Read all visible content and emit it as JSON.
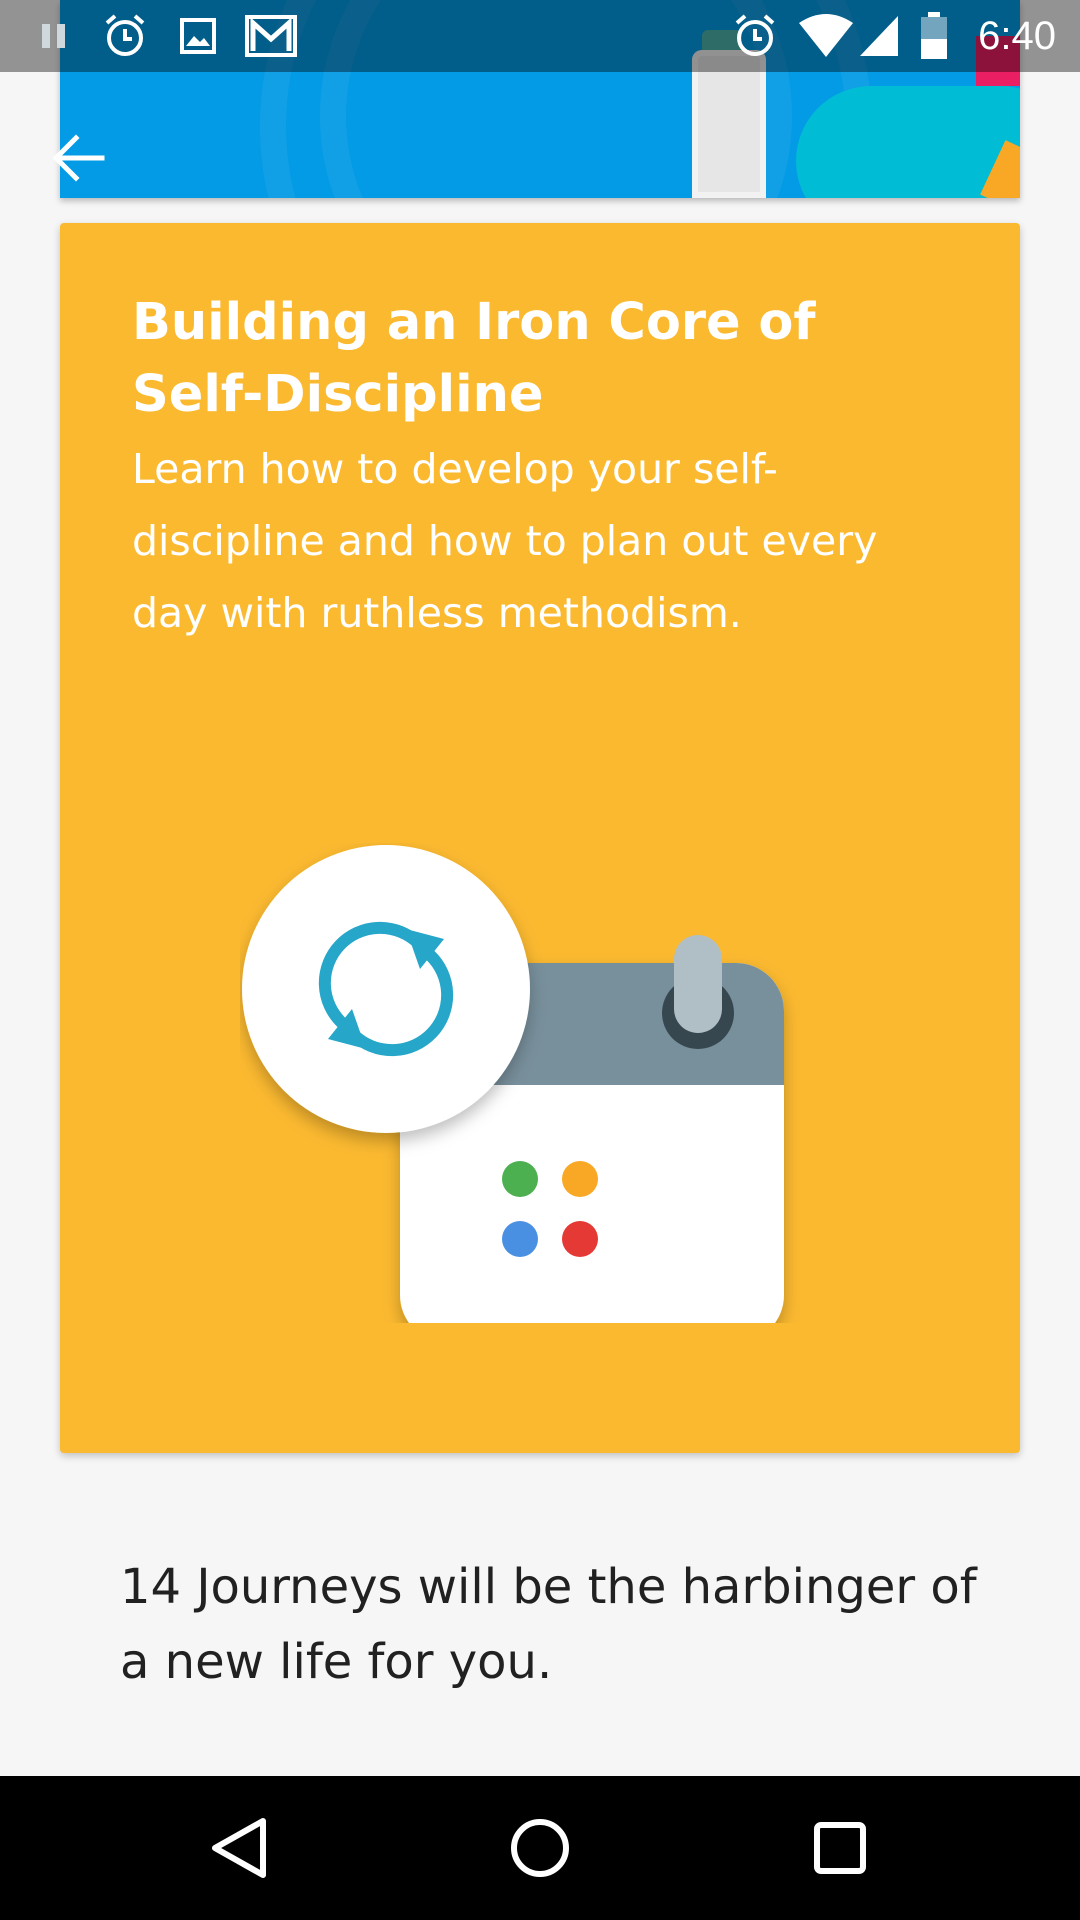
{
  "status_bar": {
    "time": "6:40",
    "left_icons": [
      "pause-icon",
      "alarm-icon",
      "image-icon",
      "gmail-icon"
    ],
    "right_icons": [
      "alarm-icon",
      "wifi-icon",
      "signal-icon",
      "battery-icon"
    ]
  },
  "header": {
    "back_icon": "arrow-left-icon",
    "banner_color": "#039be5"
  },
  "card": {
    "title": "Building an Iron Core of Self-Discipline",
    "description": "Learn how to develop your self-discipline and how to plan out every day with ruthless methodism.",
    "background_color": "#fbb930",
    "illustration": {
      "icon": "refresh-icon",
      "calendar_dot_colors": [
        "#4caf50",
        "#f9a825",
        "#4a90e2",
        "#e53935"
      ]
    }
  },
  "footer": {
    "journeys_text": "14 Journeys will be the harbinger of a new life for you."
  },
  "nav_bar": {
    "buttons": [
      "back-nav-icon",
      "home-nav-icon",
      "recents-nav-icon"
    ]
  }
}
